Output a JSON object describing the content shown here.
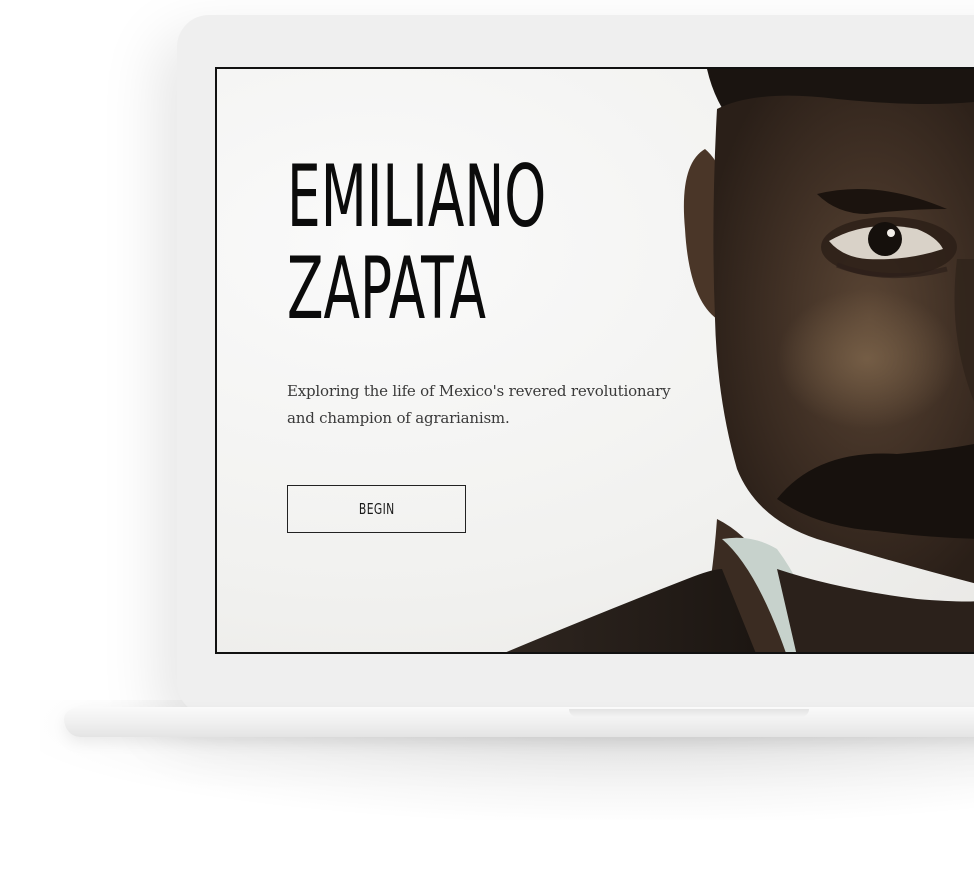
{
  "hero": {
    "title_line1": "EMILIANO",
    "title_line2": "ZAPATA",
    "subtitle": "Exploring the life of Mexico's revered revolutionary and champion of agrarianism.",
    "button_label": "BEGIN"
  },
  "images": {
    "portrait": "zapata-portrait-image"
  },
  "colors": {
    "text": "#0b0b0b",
    "screen_border": "#111111",
    "device": "#efefef"
  }
}
